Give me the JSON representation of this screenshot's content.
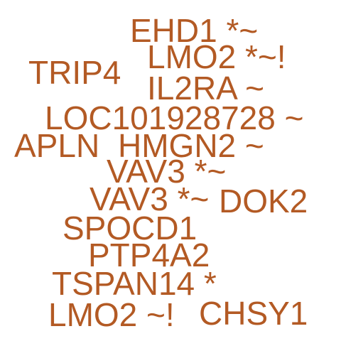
{
  "style": {
    "text_color": "#b35a24",
    "background": "#ffffff"
  },
  "words": [
    "EHD1 *~",
    "LMO2 *~!",
    "TRIP4",
    "IL2RA ~",
    "LOC101928728 ~",
    "APLN",
    "HMGN2 ~",
    "VAV3 *~",
    "VAV3 *~",
    "DOK2",
    "SPOCD1",
    "PTP4A2",
    "TSPAN14 *",
    "LMO2 ~!",
    "CHSY1"
  ]
}
